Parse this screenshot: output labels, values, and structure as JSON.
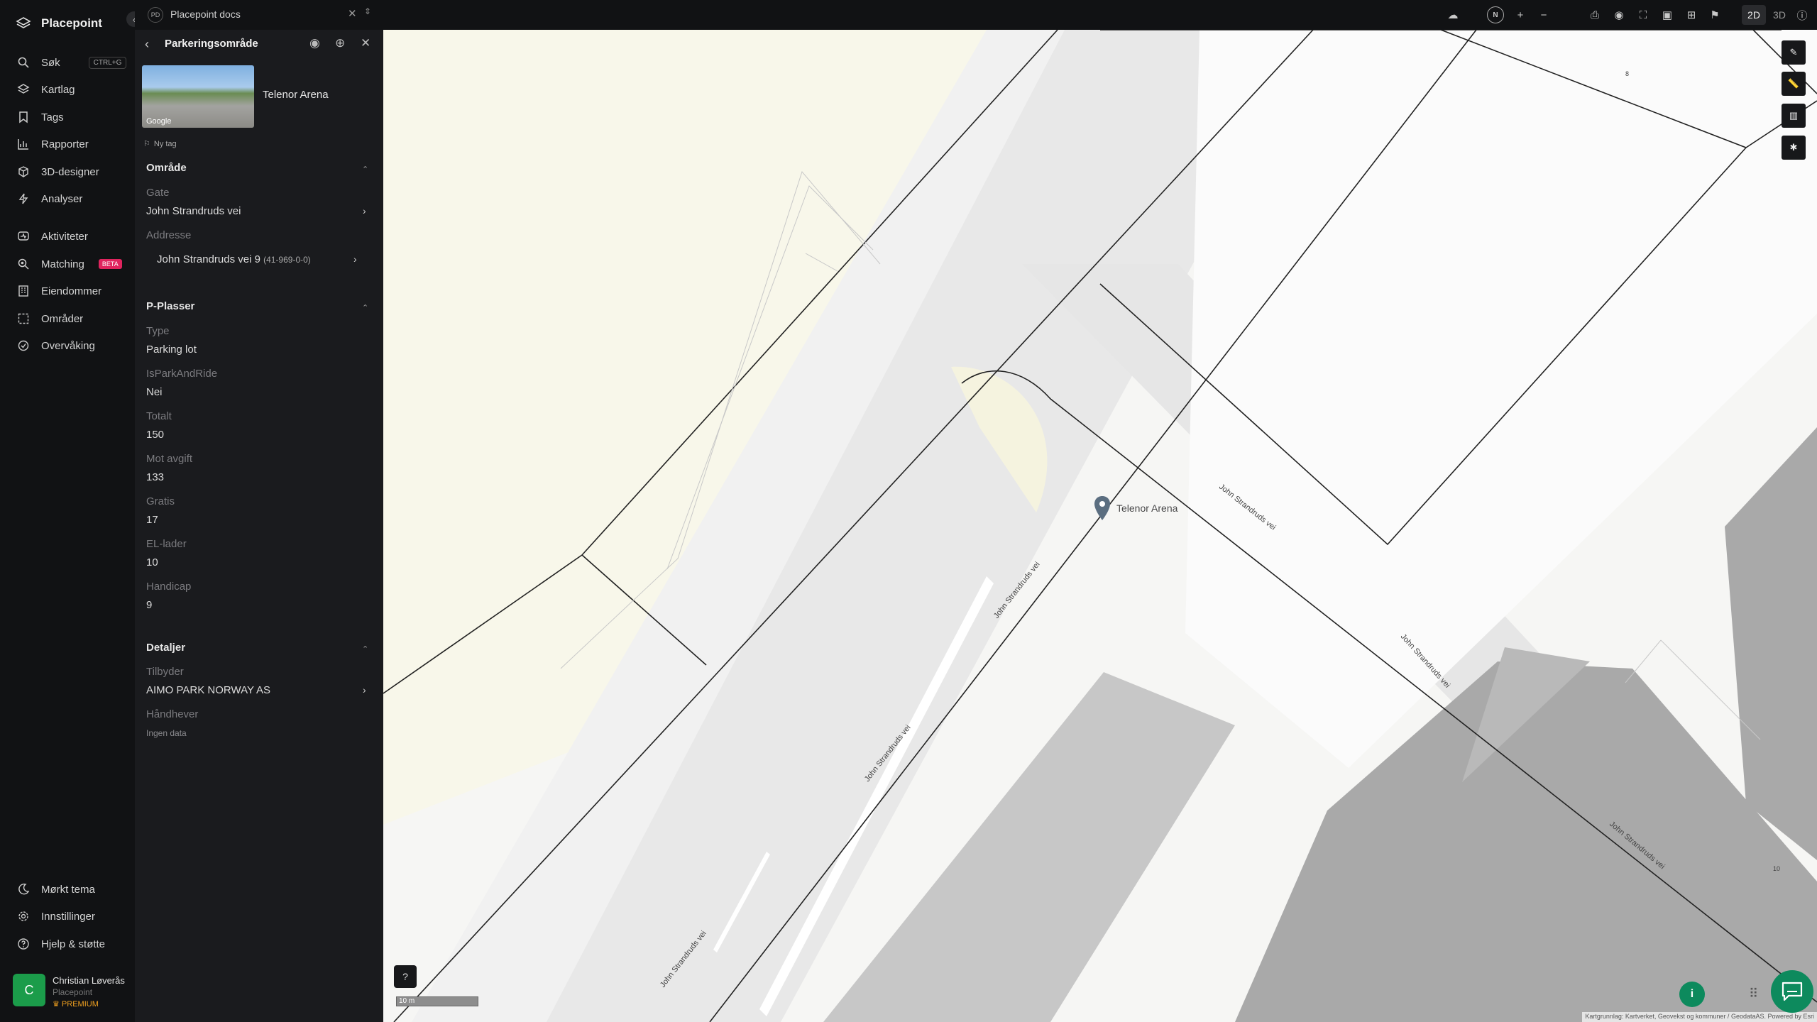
{
  "nav": {
    "brand": "Placepoint",
    "items": [
      {
        "label": "Søk",
        "shortcut": "CTRL+G"
      },
      {
        "label": "Kartlag"
      },
      {
        "label": "Tags"
      },
      {
        "label": "Rapporter"
      },
      {
        "label": "3D-designer"
      },
      {
        "label": "Analyser"
      },
      {
        "label": "Aktiviteter"
      },
      {
        "label": "Matching",
        "badge": "BETA"
      },
      {
        "label": "Eiendommer"
      },
      {
        "label": "Områder"
      },
      {
        "label": "Overvåking"
      }
    ],
    "bottom": [
      {
        "label": "Mørkt tema"
      },
      {
        "label": "Innstillinger"
      },
      {
        "label": "Hjelp & støtte"
      }
    ],
    "user": {
      "initial": "C",
      "name": "Christian Løverås",
      "org": "Placepoint",
      "plan": "PREMIUM"
    }
  },
  "topbar": {
    "doc_badge": "PD",
    "doc_title": "Placepoint docs",
    "compass": "N",
    "view_2d": "2D",
    "view_3d": "3D"
  },
  "panel": {
    "title": "Parkeringsområde",
    "place_name": "Telenor Arena",
    "thumb_credit": "Google",
    "new_tag": "Ny tag",
    "sections": {
      "area": {
        "title": "Område",
        "street_label": "Gate",
        "street_value": "John Strandruds vei",
        "address_label": "Addresse",
        "address_value": "John Strandruds vei 9",
        "address_unit": "(41-969-0-0)"
      },
      "parking": {
        "title": "P-Plasser",
        "type_label": "Type",
        "type_value": "Parking lot",
        "pr_label": "IsParkAndRide",
        "pr_value": "Nei",
        "total_label": "Totalt",
        "total_value": "150",
        "paid_label": "Mot avgift",
        "paid_value": "133",
        "free_label": "Gratis",
        "free_value": "17",
        "ev_label": "EL-lader",
        "ev_value": "10",
        "hc_label": "Handicap",
        "hc_value": "9"
      },
      "details": {
        "title": "Detaljer",
        "provider_label": "Tilbyder",
        "provider_value": "AIMO PARK NORWAY AS",
        "enforcer_label": "Håndhever",
        "enforcer_value": "Ingen data"
      }
    }
  },
  "map": {
    "marker_label": "Telenor Arena",
    "street_label": "John Strandruds vei",
    "plot_no_a": "8",
    "plot_no_b": "10",
    "scale_label": "10 m",
    "attribution": "Kartgrunnlag: Kartverket, Geovekst og kommuner / GeodataAS. Powered by Esri",
    "info_label": "i",
    "accent": "#0d8a5d"
  }
}
